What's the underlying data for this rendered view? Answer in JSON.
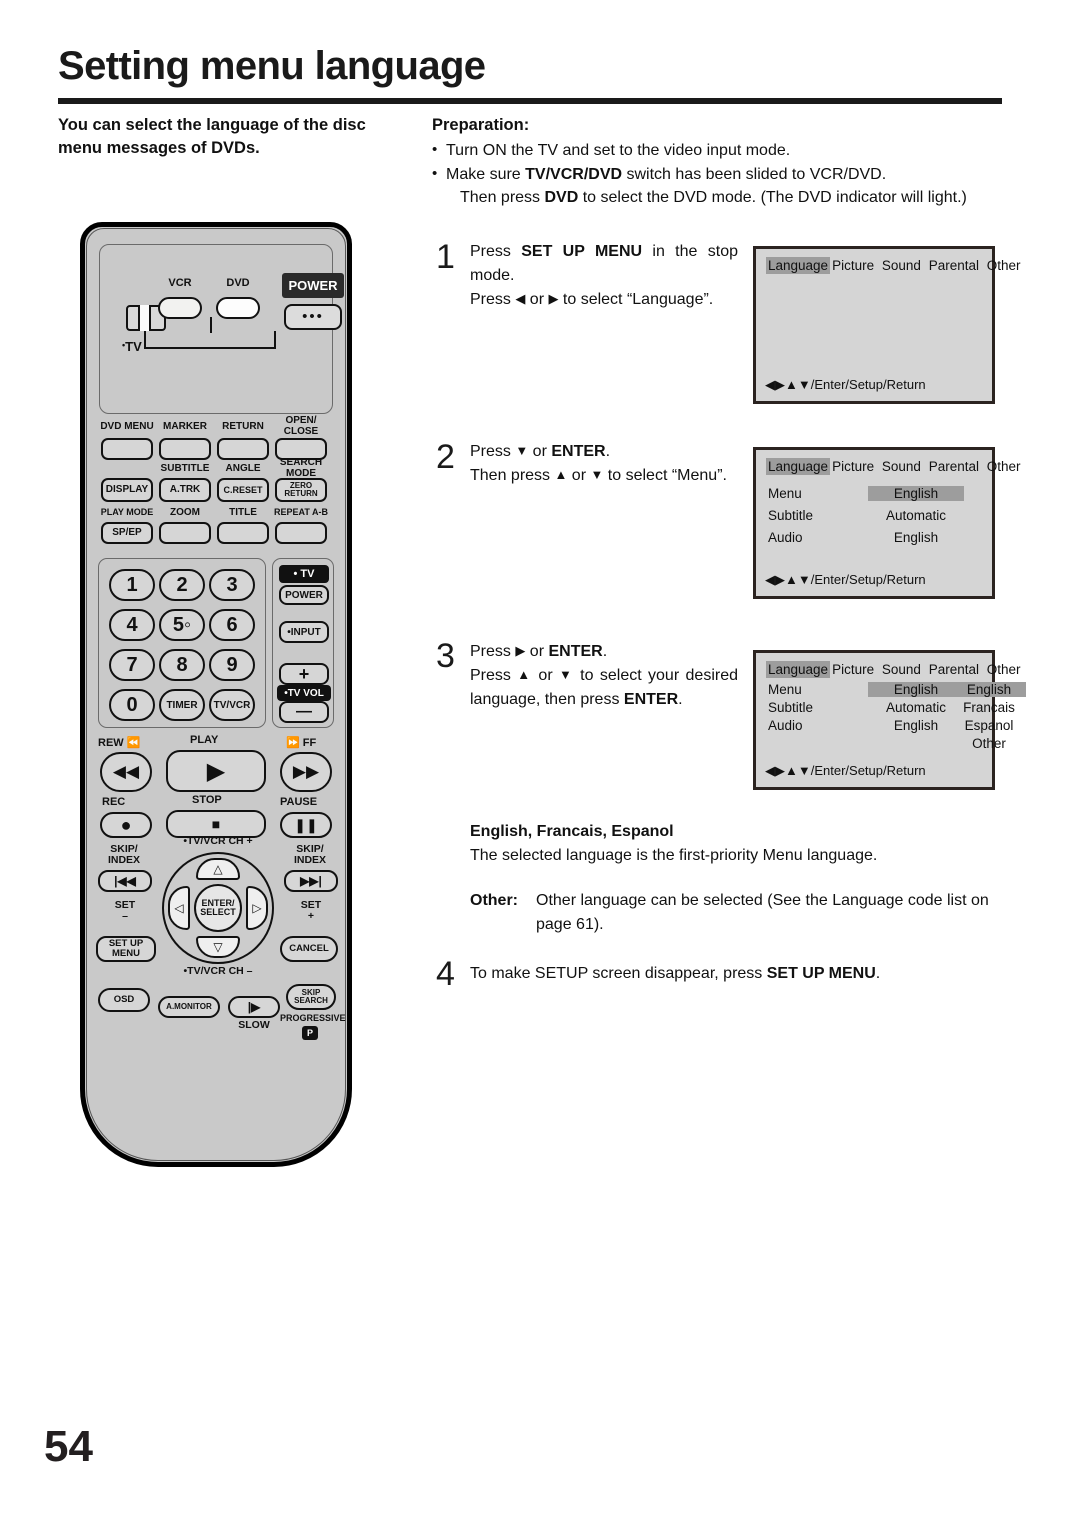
{
  "page": {
    "title": "Setting menu language",
    "number": "54"
  },
  "intro": {
    "text": "You can select the language of the disc menu messages of DVDs."
  },
  "preparation": {
    "heading": "Preparation:",
    "bullet": "•",
    "items": [
      {
        "text": "Turn ON the TV and set to the video input mode."
      },
      {
        "text_before": "Make sure ",
        "kw": "TV/VCR/DVD",
        "text_after": " switch has been slided to VCR/DVD.",
        "sub_before": "Then press ",
        "sub_kw": "DVD",
        "sub_after": " to select the DVD mode. (The DVD indicator will light.)"
      }
    ]
  },
  "steps": [
    {
      "num": "1",
      "line1_a": "Press ",
      "line1_kw": "SET UP MENU",
      "line1_b": " in the stop mode.",
      "line2_a": "Press ",
      "line2_icon1": "◀",
      "line2_b": " or ",
      "line2_icon2": "▶",
      "line2_c": " to select “Language”."
    },
    {
      "num": "2",
      "line1_a": "Press ",
      "line1_icon": "▼",
      "line1_b": " or ",
      "line1_kw": "ENTER",
      "line1_c": ".",
      "line2_a": "Then press ",
      "line2_icon1": "▲",
      "line2_b": " or ",
      "line2_icon2": "▼",
      "line2_c": " to select “Menu”."
    },
    {
      "num": "3",
      "line1_a": "Press ",
      "line1_icon": "▶",
      "line1_b": " or ",
      "line1_kw": "ENTER",
      "line1_c": ".",
      "line2_a": "Press ",
      "line2_icon1": "▲",
      "line2_b": " or ",
      "line2_icon2": "▼",
      "line2_c": " to select your desired language, then press ",
      "line2_kw": "ENTER",
      "line2_d": "."
    },
    {
      "num": "4",
      "text_a": "To make SETUP screen disappear, press ",
      "kw": "SET UP MENU",
      "text_b": "."
    }
  ],
  "note": {
    "title": "English, Francais, Espanol",
    "body": "The selected language is the first-priority Menu language.",
    "other_kw": "Other:",
    "other_text": "Other language can be selected (See the Language code list on page 61)."
  },
  "osd": {
    "tabs": [
      "Language",
      "Picture",
      "Sound",
      "Parental",
      "Other"
    ],
    "selected_tab": "Language",
    "nav": "◀▶▲▼/Enter/Setup/Return",
    "highlight_color": "#9d9d9d",
    "background_color": "#d5d5d5",
    "screens": [
      {
        "id": "screen-1",
        "rows": []
      },
      {
        "id": "screen-2",
        "rows": [
          {
            "label": "Menu",
            "value": "English",
            "selected": true
          },
          {
            "label": "Subtitle",
            "value": "Automatic",
            "selected": false
          },
          {
            "label": "Audio",
            "value": "English",
            "selected": false
          }
        ]
      },
      {
        "id": "screen-3",
        "rows": [
          {
            "label": "Menu",
            "value": "English",
            "selected": true
          },
          {
            "label": "Subtitle",
            "value": "Automatic",
            "selected": false
          },
          {
            "label": "Audio",
            "value": "English",
            "selected": false
          }
        ],
        "submenu": [
          {
            "label": "English",
            "selected": true
          },
          {
            "label": "Francais",
            "selected": false
          },
          {
            "label": "Espanol",
            "selected": false
          },
          {
            "label": "Other",
            "selected": false
          }
        ]
      }
    ]
  },
  "remote": {
    "top_panel": {
      "tv_slider_label": "TV",
      "vcr_label": "VCR",
      "dvd_label": "DVD",
      "power_label": "POWER",
      "power_dots": "•••"
    },
    "fn_grid": [
      {
        "label": "DVD MENU",
        "btn": ""
      },
      {
        "label": "MARKER",
        "btn": ""
      },
      {
        "label": "RETURN",
        "btn": ""
      },
      {
        "label": "OPEN/\nCLOSE",
        "btn": ""
      },
      {
        "label": "",
        "btn": "DISPLAY"
      },
      {
        "label": "SUBTITLE",
        "btn": "A.TRK"
      },
      {
        "label": "ANGLE",
        "btn": "C.RESET"
      },
      {
        "label": "SEARCH\nMODE",
        "btn": "ZERO\nRETURN"
      },
      {
        "label": "PLAY MODE",
        "btn": "SP/EP"
      },
      {
        "label": "ZOOM",
        "btn": ""
      },
      {
        "label": "TITLE",
        "btn": ""
      },
      {
        "label": "REPEAT A-B",
        "btn": ""
      }
    ],
    "keypad": [
      "1",
      "2",
      "3",
      "4",
      "5",
      "6",
      "7",
      "8",
      "9",
      "0",
      "TIMER",
      "TV/VCR"
    ],
    "keypad_five_mark": "5◦",
    "tv_column": {
      "tv_label": "• TV",
      "power": "POWER",
      "input": "•INPUT",
      "plus": "+",
      "tv_vol": "•TV VOL",
      "minus": "—"
    },
    "transport": {
      "rew": "REW",
      "play": "PLAY",
      "ff": "FF",
      "rec": "REC",
      "stop": "STOP",
      "pause": "PAUSE"
    },
    "dpad": {
      "ch_up": "•TV/VCR CH +",
      "ch_down": "•TV/VCR CH –",
      "enter": "ENTER/\nSELECT",
      "skip_index_left": "SKIP/\nINDEX",
      "skip_index_right": "SKIP/\nINDEX",
      "set_minus": "SET\n–",
      "set_plus": "SET\n+",
      "setup_menu": "SET UP\nMENU",
      "cancel": "CANCEL"
    },
    "bottom": {
      "osd": "OSD",
      "a_monitor": "A.MONITOR",
      "slow": "SLOW",
      "skip_search": "SKIP\nSEARCH",
      "progressive": "PROGRESSIVE",
      "progressive_badge": "P"
    }
  }
}
